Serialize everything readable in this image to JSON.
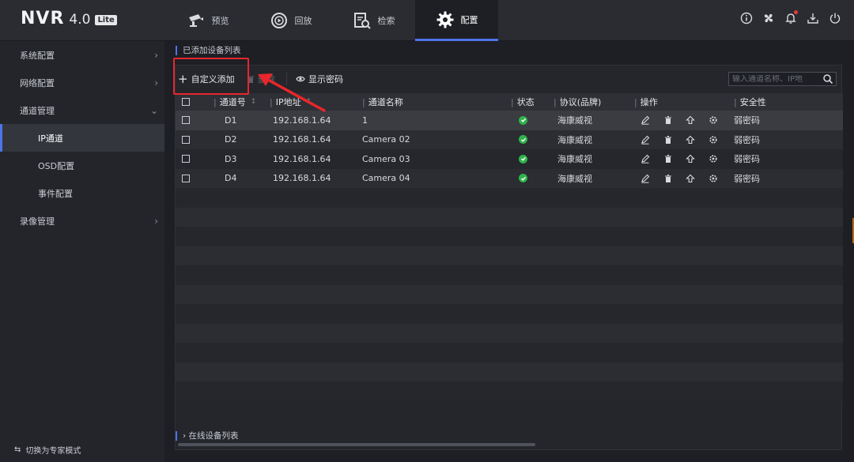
{
  "brand": {
    "name": "NVR",
    "version": "4.0",
    "edition": "Lite"
  },
  "nav_tabs": [
    {
      "label": "预览",
      "icon": "camera-icon"
    },
    {
      "label": "回放",
      "icon": "playback-icon"
    },
    {
      "label": "检索",
      "icon": "search-doc-icon"
    },
    {
      "label": "配置",
      "icon": "gear-icon",
      "active": true
    }
  ],
  "top_icons": [
    "info-icon",
    "fan-icon",
    "bell-icon",
    "download-icon",
    "power-icon"
  ],
  "sidebar": {
    "items": [
      {
        "label": "系统配置",
        "chevron": "›"
      },
      {
        "label": "网络配置",
        "chevron": "›"
      },
      {
        "label": "通道管理",
        "chevron": "⌄"
      }
    ],
    "sub_items": [
      {
        "label": "IP通道",
        "active": true
      },
      {
        "label": "OSD配置"
      },
      {
        "label": "事件配置"
      }
    ],
    "after": {
      "label": "录像管理",
      "chevron": "›"
    },
    "expert_mode": "切换为专家模式",
    "expert_icon": "⇆"
  },
  "main": {
    "section_title": "已添加设备列表",
    "toolbar": {
      "add_label": "自定义添加",
      "add_symbol": "+",
      "delete_label": "删除",
      "show_password_label": "显示密码"
    },
    "search_placeholder": "输入通道名称、IP地",
    "columns": {
      "channel_no": "通道号",
      "ip": "IP地址",
      "name": "通道名称",
      "status": "状态",
      "protocol": "协议(品牌)",
      "ops": "操作",
      "security": "安全性"
    },
    "rows": [
      {
        "no": "D1",
        "ip": "192.168.1.64",
        "name": "1",
        "status": "ok",
        "protocol": "海康威视",
        "security": "弱密码"
      },
      {
        "no": "D2",
        "ip": "192.168.1.64",
        "name": "Camera 02",
        "status": "ok",
        "protocol": "海康威视",
        "security": "弱密码"
      },
      {
        "no": "D3",
        "ip": "192.168.1.64",
        "name": "Camera 03",
        "status": "ok",
        "protocol": "海康威视",
        "security": "弱密码"
      },
      {
        "no": "D4",
        "ip": "192.168.1.64",
        "name": "Camera 04",
        "status": "ok",
        "protocol": "海康威视",
        "security": "弱密码"
      }
    ],
    "online_section": "在线设备列表",
    "online_chevron": "›"
  },
  "colors": {
    "accent": "#4f73e8",
    "ok": "#2fb34a",
    "annotation": "#e8262b"
  }
}
